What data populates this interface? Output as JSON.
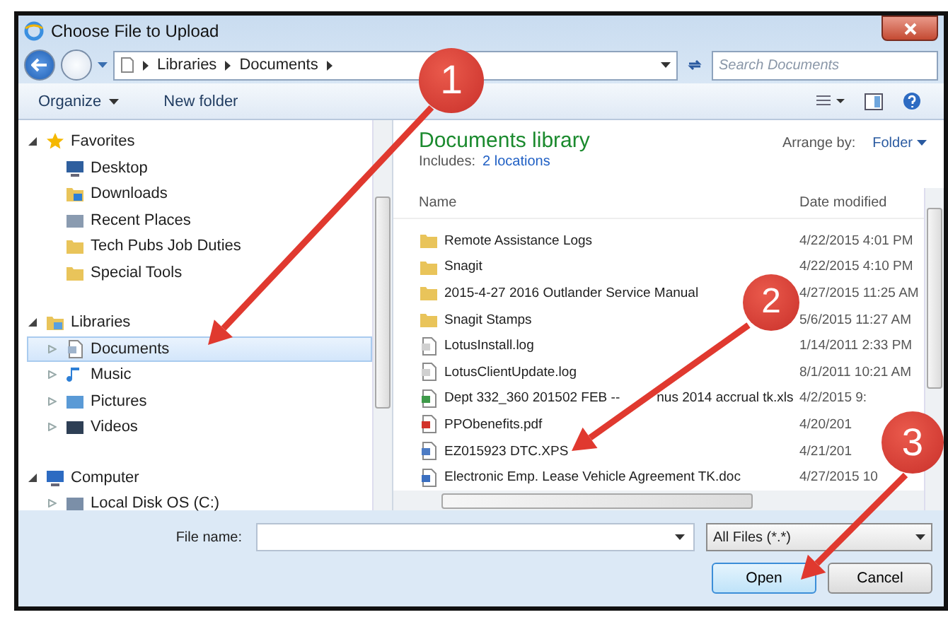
{
  "window": {
    "title": "Choose File to Upload"
  },
  "address": {
    "crumbs": [
      "Libraries",
      "Documents"
    ]
  },
  "search": {
    "placeholder": "Search Documents"
  },
  "toolbar": [
    {
      "label": "Organize",
      "dropdown": true
    },
    {
      "label": "New folder",
      "dropdown": false
    }
  ],
  "nav": [
    {
      "label": "Favorites",
      "kind": "star",
      "expanded": true,
      "selected": false,
      "children": [
        {
          "label": "Desktop",
          "kind": "desktop",
          "selected": false
        },
        {
          "label": "Downloads",
          "kind": "downloads",
          "selected": false
        },
        {
          "label": "Recent Places",
          "kind": "recent",
          "selected": false
        },
        {
          "label": "Tech Pubs Job Duties",
          "kind": "folder",
          "selected": false
        },
        {
          "label": "Special Tools",
          "kind": "folder",
          "selected": false
        }
      ]
    },
    {
      "label": "Libraries",
      "kind": "library",
      "expanded": true,
      "selected": false,
      "children": [
        {
          "label": "Documents",
          "kind": "document",
          "expanded": false,
          "selected": true
        },
        {
          "label": "Music",
          "kind": "music",
          "expanded": false,
          "selected": false
        },
        {
          "label": "Pictures",
          "kind": "pictures",
          "expanded": false,
          "selected": false
        },
        {
          "label": "Videos",
          "kind": "videos",
          "expanded": false,
          "selected": false
        }
      ]
    },
    {
      "label": "Computer",
      "kind": "computer",
      "expanded": true,
      "selected": false,
      "children": [
        {
          "label": "Local Disk OS (C:)",
          "kind": "disk",
          "expanded": false,
          "selected": false
        }
      ]
    }
  ],
  "library": {
    "title": "Documents library",
    "includes_label": "Includes:",
    "includes_link": "2 locations",
    "arrange_label": "Arrange by:",
    "arrange_value": "Folder"
  },
  "columns": [
    "Name",
    "Date modified"
  ],
  "files": [
    {
      "name": "Remote Assistance Logs",
      "date": "4/22/2015 4:01 PM",
      "kind": "folder"
    },
    {
      "name": "Snagit",
      "date": "4/22/2015 4:10 PM",
      "kind": "folder"
    },
    {
      "name": "2015-4-27 2016 Outlander Service Manual",
      "date": "4/27/2015 11:25 AM",
      "kind": "folder"
    },
    {
      "name": "Snagit Stamps",
      "date": "5/6/2015 11:27 AM",
      "kind": "folder"
    },
    {
      "name": "LotusInstall.log",
      "date": "1/14/2011 2:33 PM",
      "kind": "text"
    },
    {
      "name": "LotusClientUpdate.log",
      "date": "8/1/2011 10:21 AM",
      "kind": "text"
    },
    {
      "name": "Dept 332_360 201502 FEB --",
      "name_tail": "nus 2014 accrual tk.xls",
      "date": "4/2/2015 9:",
      "kind": "sheet"
    },
    {
      "name": "PPObenefits.pdf",
      "date": "4/20/201",
      "kind": "pdf"
    },
    {
      "name": "EZ015923 DTC.XPS",
      "date": "4/21/201",
      "kind": "xps"
    },
    {
      "name": "Electronic Emp. Lease Vehicle Agreement TK.doc",
      "date": "4/27/2015 10",
      "kind": "word"
    }
  ],
  "file_name": {
    "label": "File name:"
  },
  "file_type": "All Files (*.*)",
  "buttons": [
    {
      "label": "Open",
      "default": true
    },
    {
      "label": "Cancel",
      "default": false
    }
  ],
  "callouts": [
    "1",
    "2",
    "3"
  ]
}
